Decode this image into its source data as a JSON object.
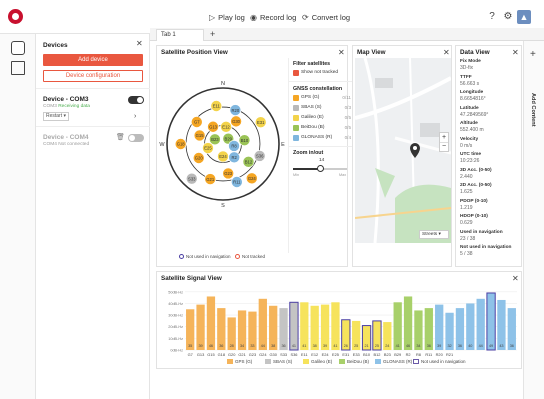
{
  "toolbar": {
    "play_log": "Play log",
    "record_log": "Record log",
    "convert_log": "Convert log"
  },
  "devices_panel": {
    "title": "Devices",
    "add_device": "Add device",
    "device_configuration": "Device configuration",
    "devices": [
      {
        "name": "Device - COM3",
        "port": "COM3",
        "status": "Receiving data",
        "connected": true,
        "select_value": "Restart"
      },
      {
        "name": "Device - COM4",
        "port": "COM4",
        "status": "Not connected",
        "connected": false
      }
    ]
  },
  "tabs": [
    {
      "label": "Tab 1"
    }
  ],
  "satellite_position": {
    "title": "Satellite Position View",
    "filter_title": "Filter satellites",
    "show_not_tracked": "Show not tracked",
    "constellation_title": "GNSS constellation",
    "constellations": [
      {
        "label": "GPS (G)",
        "count": "0/11",
        "color": "#f5a623"
      },
      {
        "label": "SBAS (S)",
        "count": "0/3",
        "color": "#b9b9b9"
      },
      {
        "label": "Galileo (E)",
        "count": "0/5",
        "color": "#f3d34a"
      },
      {
        "label": "BeiDou (B)",
        "count": "0/5",
        "color": "#9ac356"
      },
      {
        "label": "GLONASS (R)",
        "count": "0/4",
        "color": "#7fb6de"
      }
    ],
    "zoom_title": "Zoom in/out",
    "zoom_value": 14,
    "zoom_min": "Min",
    "zoom_max": "Max",
    "compass": {
      "n": "N",
      "e": "E",
      "s": "S",
      "w": "W"
    },
    "legend_not_used": "Not used in navigation",
    "legend_not_tracked": "Not tracked",
    "satellites": [
      {
        "id": "G7",
        "az": 310,
        "el": 35,
        "c": "#f5a623"
      },
      {
        "id": "G13",
        "az": 330,
        "el": 58,
        "c": "#f5a623"
      },
      {
        "id": "G15",
        "az": 290,
        "el": 50,
        "c": "#f5a623"
      },
      {
        "id": "G18",
        "az": 270,
        "el": 22,
        "c": "#f5a623"
      },
      {
        "id": "G20",
        "az": 240,
        "el": 45,
        "c": "#f5a623"
      },
      {
        "id": "G21",
        "az": 200,
        "el": 30,
        "c": "#f5a623"
      },
      {
        "id": "G23",
        "az": 170,
        "el": 42,
        "c": "#f5a623"
      },
      {
        "id": "G24",
        "az": 140,
        "el": 18,
        "c": "#f5a623"
      },
      {
        "id": "G30",
        "az": 30,
        "el": 48,
        "c": "#f5a623"
      },
      {
        "id": "S33",
        "az": 222,
        "el": 15,
        "c": "#b9b9b9"
      },
      {
        "id": "S36",
        "az": 108,
        "el": 28,
        "c": "#b9b9b9"
      },
      {
        "id": "E11",
        "az": 350,
        "el": 28,
        "c": "#f3d34a"
      },
      {
        "id": "E12",
        "az": 10,
        "el": 62,
        "c": "#f3d34a"
      },
      {
        "id": "E24",
        "az": 180,
        "el": 70,
        "c": "#f3d34a"
      },
      {
        "id": "E25",
        "az": 255,
        "el": 65,
        "c": "#f3d34a"
      },
      {
        "id": "E31",
        "az": 60,
        "el": 20,
        "c": "#f3d34a"
      },
      {
        "id": "B10",
        "az": 80,
        "el": 55,
        "c": "#9ac356"
      },
      {
        "id": "B12",
        "az": 125,
        "el": 40,
        "c": "#9ac356"
      },
      {
        "id": "B23",
        "az": 300,
        "el": 75,
        "c": "#9ac356"
      },
      {
        "id": "B29",
        "az": 45,
        "el": 78,
        "c": "#9ac356"
      },
      {
        "id": "R2",
        "az": 140,
        "el": 62,
        "c": "#7fb6de"
      },
      {
        "id": "R8",
        "az": 100,
        "el": 72,
        "c": "#7fb6de"
      },
      {
        "id": "R11",
        "az": 160,
        "el": 25,
        "c": "#7fb6de"
      },
      {
        "id": "R20",
        "az": 20,
        "el": 32,
        "c": "#7fb6de"
      }
    ]
  },
  "map_view": {
    "title": "Map View",
    "zoom_in": "+",
    "zoom_out": "−",
    "layer_select": "Streets"
  },
  "data_view": {
    "title": "Data View",
    "items": [
      {
        "label": "Fix Mode",
        "value": "3D-fix"
      },
      {
        "label": "TTFF",
        "value": "56.663 s"
      },
      {
        "label": "Longitude",
        "value": "8.6654816°"
      },
      {
        "label": "Latitude",
        "value": "47.2849569°"
      },
      {
        "label": "Altitude",
        "value": "552.400 m"
      },
      {
        "label": "Velocity",
        "value": "0 m/s"
      },
      {
        "label": "UTC time",
        "value": "10:23:26"
      },
      {
        "label": "3D Acc. (0-50)",
        "value": "2.440"
      },
      {
        "label": "2D Acc. (0-50)",
        "value": "1.625"
      },
      {
        "label": "PDOP (0-10)",
        "value": "1.219"
      },
      {
        "label": "HDOP (0-10)",
        "value": "0.629"
      },
      {
        "label": "Used in navigation",
        "value": "23 / 38"
      },
      {
        "label": "Not used in navigation",
        "value": "5 / 38"
      }
    ]
  },
  "add_content": "Add Content",
  "signal_view": {
    "title": "Satellite Signal View",
    "legend": [
      {
        "label": "GPS (G)",
        "color": "#f5b45a"
      },
      {
        "label": "SBAS (S)",
        "color": "#c4c4c4"
      },
      {
        "label": "Galileo (E)",
        "color": "#f6e35c"
      },
      {
        "label": "BeiDou (B)",
        "color": "#a8d06a"
      },
      {
        "label": "GLONASS (R)",
        "color": "#8ec2e8"
      },
      {
        "label": "Not used in navigation",
        "color": "#6a5aa8"
      }
    ]
  },
  "chart_data": {
    "type": "bar",
    "title": "Satellite Signal View",
    "ylabel": "",
    "y_ticks": [
      "0dB-Hz",
      "10dB-Hz",
      "20dB-Hz",
      "30dB-Hz",
      "40dB-Hz",
      "50dB-Hz"
    ],
    "ylim": [
      0,
      55
    ],
    "grid": true,
    "categories": [
      "G7",
      "G13",
      "G15",
      "G18",
      "G20",
      "G21",
      "G23",
      "G24",
      "G30",
      "S33",
      "S36",
      "E11",
      "E12",
      "E24",
      "E25",
      "E31",
      "E33",
      "B10",
      "B12",
      "B23",
      "B29",
      "R2",
      "R8",
      "R11",
      "R20",
      "R21"
    ],
    "values": [
      35,
      39,
      46,
      36,
      28,
      34,
      33,
      44,
      38,
      36,
      41,
      41,
      38,
      39,
      41,
      26,
      25,
      21,
      25,
      24,
      41,
      46,
      34,
      36,
      39,
      32,
      36,
      40,
      44,
      49,
      43,
      36
    ],
    "labels": [
      "35",
      "39",
      "46",
      "36",
      "28",
      "34",
      "33",
      "44",
      "38",
      "36",
      "41",
      "41",
      "38",
      "39",
      "41",
      "26",
      "25",
      "21",
      "25",
      "24",
      "41",
      "46",
      "34",
      "36",
      "39",
      "32",
      "36",
      "40",
      "44",
      "49",
      "43",
      "36"
    ],
    "colors": [
      "#f5b45a",
      "#f5b45a",
      "#f5b45a",
      "#f5b45a",
      "#f5b45a",
      "#f5b45a",
      "#f5b45a",
      "#f5b45a",
      "#f5b45a",
      "#c4c4c4",
      "#c4c4c4",
      "#f6e35c",
      "#f6e35c",
      "#f6e35c",
      "#f6e35c",
      "#f6e35c",
      "#f6e35c",
      "#f6e35c",
      "#f6e35c",
      "#f6e35c",
      "#a8d06a",
      "#a8d06a",
      "#a8d06a",
      "#a8d06a",
      "#8ec2e8",
      "#8ec2e8",
      "#8ec2e8",
      "#8ec2e8",
      "#8ec2e8",
      "#8ec2e8",
      "#8ec2e8",
      "#8ec2e8"
    ],
    "not_used": [
      false,
      false,
      false,
      false,
      false,
      false,
      false,
      false,
      false,
      false,
      true,
      false,
      false,
      false,
      false,
      true,
      false,
      true,
      true,
      false,
      false,
      false,
      false,
      false,
      false,
      false,
      false,
      false,
      false,
      true,
      false,
      false
    ],
    "x_labels": [
      "G7",
      "G13",
      "G15",
      "G18",
      "G20",
      "G21",
      "G23",
      "G24",
      "G30",
      "S33",
      "S36",
      "E11",
      "E12",
      "E24",
      "E25",
      "E31",
      "E33",
      "B10",
      "B12",
      "B23",
      "B29",
      "R2",
      "R8",
      "R11",
      "R20",
      "R21",
      "",
      "",
      "",
      "",
      "",
      ""
    ]
  }
}
